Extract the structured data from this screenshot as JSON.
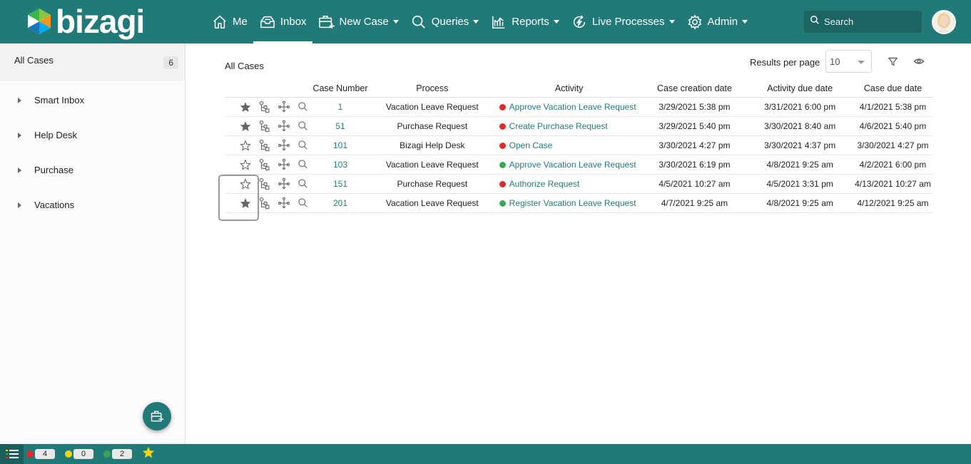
{
  "app": {
    "logo_text": "bizagi",
    "nav": [
      {
        "label": "Me",
        "icon": "home-icon",
        "has_caret": false,
        "active": false
      },
      {
        "label": "Inbox",
        "icon": "inbox-icon",
        "has_caret": false,
        "active": true
      },
      {
        "label": "New Case",
        "icon": "new-case-icon",
        "has_caret": true,
        "active": false
      },
      {
        "label": "Queries",
        "icon": "search-icon",
        "has_caret": true,
        "active": false
      },
      {
        "label": "Reports",
        "icon": "reports-icon",
        "has_caret": true,
        "active": false
      },
      {
        "label": "Live Processes",
        "icon": "live-processes-icon",
        "has_caret": true,
        "active": false
      },
      {
        "label": "Admin",
        "icon": "gear-icon",
        "has_caret": true,
        "active": false
      }
    ],
    "search": {
      "placeholder": "Search",
      "value": ""
    }
  },
  "sidebar": {
    "header": {
      "label": "All Cases",
      "count": "6"
    },
    "items": [
      {
        "label": "Smart Inbox"
      },
      {
        "label": "Help Desk"
      },
      {
        "label": "Purchase"
      },
      {
        "label": "Vacations"
      }
    ]
  },
  "main": {
    "title": "All Cases",
    "results_per_page_label": "Results per page",
    "results_per_page_value": "10",
    "columns": [
      "",
      "Case Number",
      "Process",
      "Activity",
      "Case creation date",
      "Activity due date",
      "Case due date"
    ],
    "rows": [
      {
        "favorite": true,
        "case_number": "1",
        "process": "Vacation Leave Request",
        "status": "red",
        "activity": "Approve Vacation Leave Request",
        "creation": "3/29/2021 5:38 pm",
        "activity_due": "3/31/2021 6:00 pm",
        "case_due": "4/1/2021 5:38 pm"
      },
      {
        "favorite": true,
        "case_number": "51",
        "process": "Purchase Request",
        "status": "red",
        "activity": "Create Purchase Request",
        "creation": "3/29/2021 5:40 pm",
        "activity_due": "3/30/2021 8:40 am",
        "case_due": "4/6/2021 5:40 pm"
      },
      {
        "favorite": false,
        "case_number": "101",
        "process": "Bizagi Help Desk",
        "status": "red",
        "activity": "Open Case",
        "creation": "3/30/2021 4:27 pm",
        "activity_due": "3/30/2021 4:37 pm",
        "case_due": "3/30/2021 4:27 pm"
      },
      {
        "favorite": false,
        "case_number": "103",
        "process": "Vacation Leave Request",
        "status": "green",
        "activity": "Approve Vacation Leave Request",
        "creation": "3/30/2021 6:19 pm",
        "activity_due": "4/8/2021 9:25 am",
        "case_due": "4/2/2021 6:00 pm"
      },
      {
        "favorite": false,
        "case_number": "151",
        "process": "Purchase Request",
        "status": "red",
        "activity": "Authorize Request",
        "creation": "4/5/2021 10:27 am",
        "activity_due": "4/5/2021 3:31 pm",
        "case_due": "4/13/2021 10:27 am"
      },
      {
        "favorite": true,
        "case_number": "201",
        "process": "Vacation Leave Request",
        "status": "green",
        "activity": "Register Vacation Leave Request",
        "creation": "4/7/2021 9:25 am",
        "activity_due": "4/8/2021 9:25 am",
        "case_due": "4/12/2021 9:25 am"
      }
    ]
  },
  "statusbar": {
    "red_count": "4",
    "yellow_count": "0",
    "green_count": "2"
  },
  "colors": {
    "brand": "#227a78",
    "status_red": "#e02a2a",
    "status_yellow": "#f1d712",
    "status_green": "#3aa655",
    "favorite_star": "#f1d712"
  }
}
